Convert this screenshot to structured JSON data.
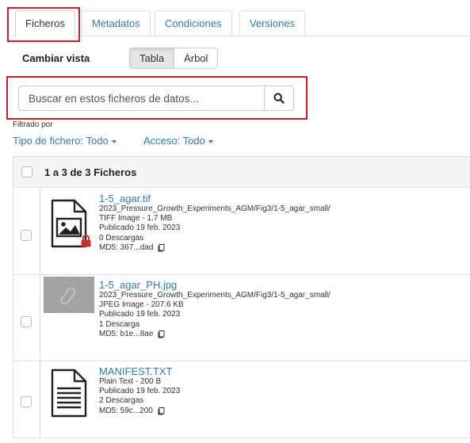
{
  "tabs": [
    {
      "label": "Ficheros",
      "active": true
    },
    {
      "label": "Metadatos"
    },
    {
      "label": "Condiciones"
    },
    {
      "label": "Versiones"
    }
  ],
  "view": {
    "label": "Cambiar vista",
    "options": [
      "Tabla",
      "Árbol"
    ],
    "selected": "Tabla"
  },
  "search": {
    "placeholder": "Buscar en estos ficheros de datos...",
    "value": ""
  },
  "filters": {
    "label": "Filtrado por",
    "file_type": "Tipo de fichero: Todo",
    "access": "Acceso: Todo"
  },
  "table": {
    "count_label": "1 a 3 de 3 Ficheros",
    "files": [
      {
        "name": "1-5_agar.tif",
        "path": "2023_Pressure_Growth_Experiments_AGM/Fig3/1-5_agar_small/",
        "type_size": "TIFF Image - 1.7 MB",
        "published": "Publicado 19 feb. 2023",
        "downloads": "0 Descargas",
        "md5": "MD5: 367...dad",
        "icon": "image-file-icon",
        "restricted": true
      },
      {
        "name": "1-5_agar_PH.jpg",
        "path": "2023_Pressure_Growth_Experiments_AGM/Fig3/1-5_agar_small/",
        "type_size": "JPEG Image - 207.6 KB",
        "published": "Publicado 19 feb. 2023",
        "downloads": "1 Descarga",
        "md5": "MD5: b1e...8ae",
        "icon": "thumbnail-image"
      },
      {
        "name": "MANIFEST.TXT",
        "path": "",
        "type_size": "Plain Text - 200 B",
        "published": "Publicado 19 feb. 2023",
        "downloads": "2 Descargas",
        "md5": "MD5: 59c...200",
        "icon": "text-file-icon"
      }
    ]
  },
  "colors": {
    "link": "#337ab7",
    "highlight": "#cc1f2a",
    "lock": "#c9302c"
  }
}
